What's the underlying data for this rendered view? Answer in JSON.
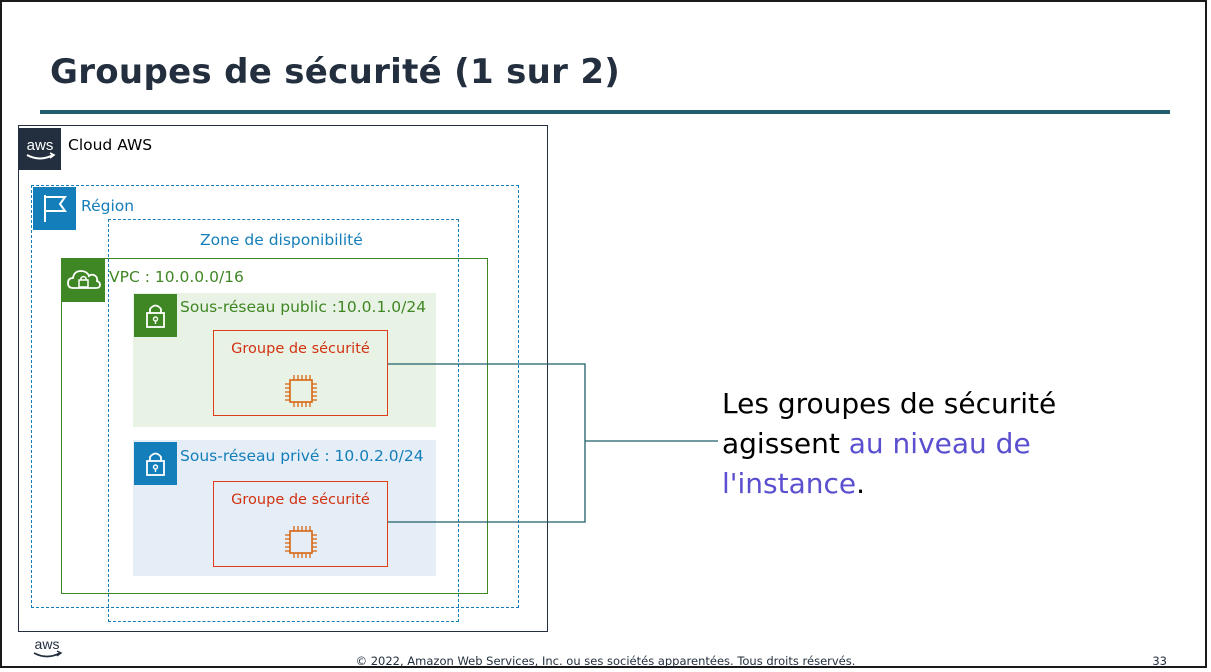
{
  "slide": {
    "title": "Groupes de sécurité (1 sur 2)",
    "footer": "© 2022, Amazon Web Services, Inc. ou ses sociétés apparentées. Tous droits réservés.",
    "page_number": "33",
    "footer_logo_text": "aws"
  },
  "diagram": {
    "cloud_label": "Cloud AWS",
    "cloud_logo_text": "aws",
    "region_label": "Région",
    "az_label": "Zone de disponibilité",
    "vpc_label": "VPC : 10.0.0.0/16",
    "public_subnet_label": "Sous-réseau public :10.0.1.0/24",
    "private_subnet_label": "Sous-réseau privé : 10.0.2.0/24",
    "security_group_label": "Groupe de sécurité"
  },
  "callout": {
    "line1": "Les groupes de sécurité",
    "line2_prefix": "agissent ",
    "line2_highlight": "au niveau de",
    "line3_highlight": "l'instance",
    "line3_suffix": "."
  },
  "colors": {
    "title": "#232f3e",
    "title_rule": "#1f5e6a",
    "region_blue": "#147eba",
    "vpc_green": "#3f8624",
    "security_group_red": "#dd3d19",
    "highlight_purple": "#5a4fcf"
  }
}
